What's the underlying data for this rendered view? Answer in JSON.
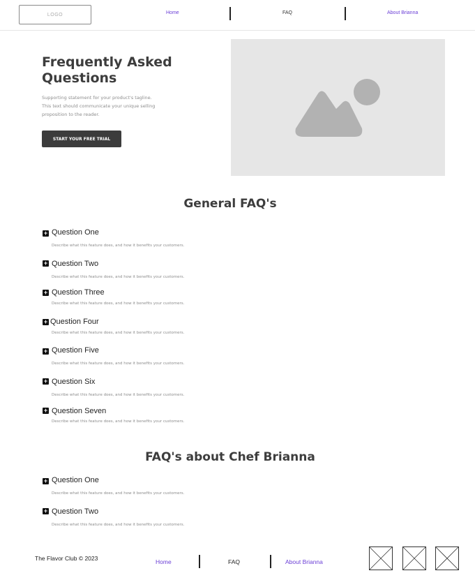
{
  "header": {
    "logo": "LOGO",
    "nav": [
      "Home",
      "FAQ",
      "About Brianna"
    ]
  },
  "hero": {
    "title_line1": "Frequently Asked",
    "title_line2": "Questions",
    "sub_line1": "Supporting statement for your product's tagline.",
    "sub_line2": "This text should communicate your unique selling",
    "sub_line3": "proposition to the reader.",
    "cta": "START YOUR FREE TRIAL",
    "image_icon": "image-placeholder-icon"
  },
  "general": {
    "title": "General FAQ's",
    "items": [
      {
        "q": "Question One",
        "d": "Describe what this feature does, and how it benefits your customers."
      },
      {
        "q": "Question Two",
        "d": "Describe what this feature does, and how it benefits your customers."
      },
      {
        "q": "Question Three",
        "d": "Describe what this feature does, and how it benefits your customers."
      },
      {
        "q": "Question Four",
        "d": "Describe what this feature does, and how it benefits your customers."
      },
      {
        "q": "Question Five",
        "d": "Describe what this feature does, and how it benefits your customers."
      },
      {
        "q": "Question Six",
        "d": "Describe what this feature does, and how it benefits your customers."
      },
      {
        "q": "Question Seven",
        "d": "Describe what this feature does, and how it benefits your customers."
      }
    ]
  },
  "chef": {
    "title": "FAQ's about Chef Brianna",
    "items": [
      {
        "q": "Question One",
        "d": "Describe what this feature does, and how it benefits your customers."
      },
      {
        "q": "Question Two",
        "d": "Describe what this feature does, and how it benefits your customers."
      }
    ]
  },
  "footer": {
    "copyright": "The Flavor Club © 2023",
    "nav": [
      "Home",
      "FAQ",
      "About Brianna"
    ],
    "social_icons": [
      "social-placeholder-icon",
      "social-placeholder-icon",
      "social-placeholder-icon"
    ]
  },
  "colors": {
    "link": "#6b3fd6",
    "button": "#3c3c3c",
    "placeholder": "#e6e6e6"
  }
}
